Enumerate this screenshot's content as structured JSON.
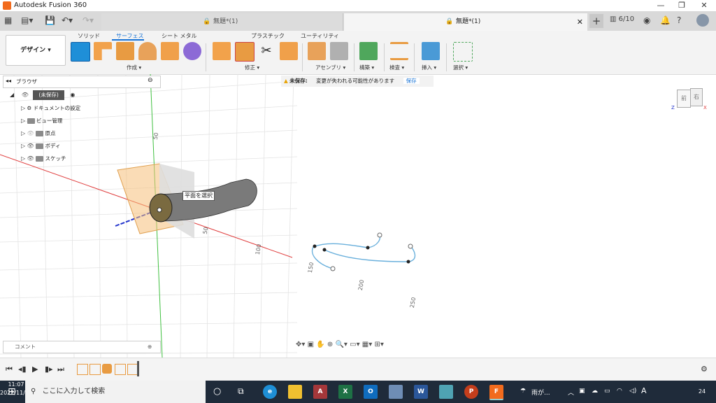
{
  "app": {
    "title": "Autodesk Fusion 360"
  },
  "window_controls": {
    "minimize": "—",
    "restore": "❐",
    "close": "✕"
  },
  "tabs": [
    {
      "label": "無題*(1)",
      "active": false
    },
    {
      "label": "無題*(1)",
      "active": true
    }
  ],
  "header": {
    "jobs": "6/10"
  },
  "workspace": {
    "label": "デザイン ▾"
  },
  "toolbar": {
    "tabs": [
      "ソリッド",
      "サーフェス",
      "シート メタル",
      "プラスチック",
      "ユーティリティ"
    ],
    "active_tab": "サーフェス",
    "groups": [
      "作成 ▾",
      "修正 ▾",
      "アセンブリ ▾",
      "構築 ▾",
      "検査 ▾",
      "挿入 ▾",
      "選択 ▾"
    ]
  },
  "browser": {
    "title": "ブラウザ",
    "root": "(未保存)",
    "items": [
      "ドキュメントの設定",
      "ビュー管理",
      "原点",
      "ボディ",
      "スケッチ"
    ]
  },
  "notice": {
    "label": "未保存:",
    "message": "変更が失われる可能性があります",
    "save": "保存"
  },
  "viewport": {
    "tooltip": "平面を選択",
    "axis_labels": [
      "50",
      "50",
      "100",
      "150",
      "200",
      "250"
    ]
  },
  "viewcube": {
    "front": "前",
    "right": "右",
    "z": "Z",
    "x": "X"
  },
  "comment": {
    "label": "コメント"
  },
  "taskbar": {
    "search_placeholder": "ここに入力して検索",
    "weather": "雨が...",
    "ime": "A",
    "time": "11:07",
    "date": "2022/11/13",
    "notifications": "24"
  },
  "colors": {
    "accent": "#1a74d6",
    "brand": "#f26b1d",
    "taskbar": "#1f2b3a"
  }
}
